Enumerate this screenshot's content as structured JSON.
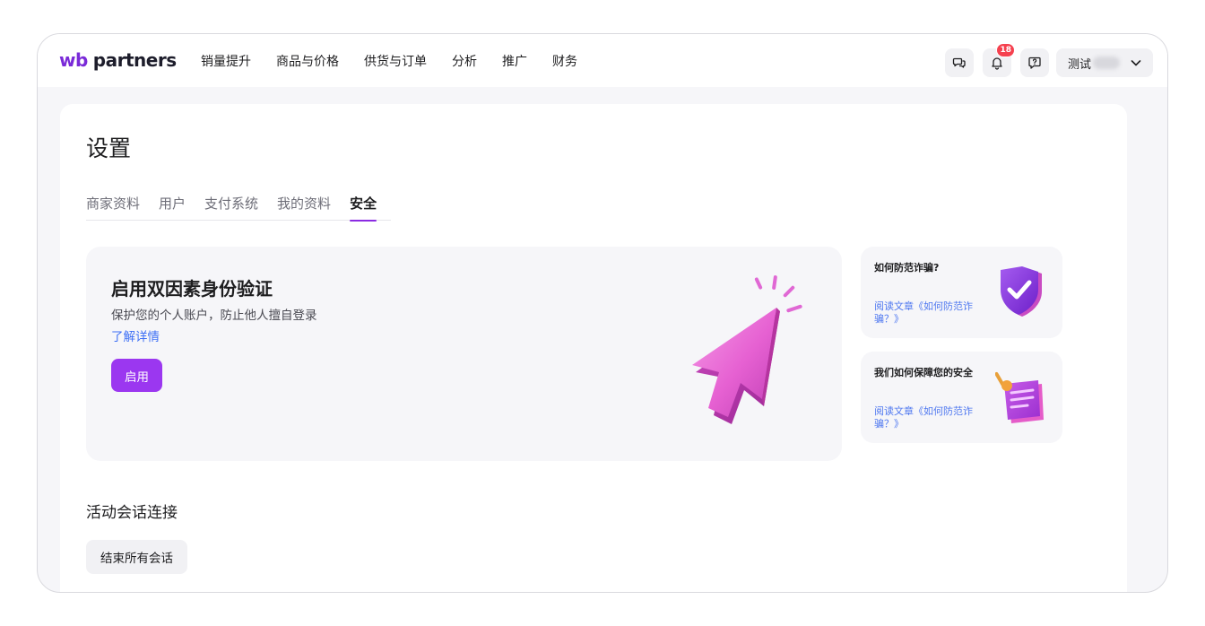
{
  "header": {
    "logo_prefix": "wb",
    "logo_suffix": "partners",
    "nav": [
      "销量提升",
      "商品与价格",
      "供货与订单",
      "分析",
      "推广",
      "财务"
    ],
    "notifications_count": "18",
    "user_name": "测试"
  },
  "page": {
    "title": "设置",
    "tabs": [
      "商家资料",
      "用户",
      "支付系统",
      "我的资料",
      "安全"
    ],
    "active_tab": "安全"
  },
  "two_factor": {
    "title": "启用双因素身份验证",
    "description": "保护您的个人账户，防止他人擅自登录",
    "link": "了解详情",
    "button": "启用"
  },
  "side_cards": [
    {
      "title": "如何防范诈骗?",
      "link": "阅读文章《如何防范诈骗？》"
    },
    {
      "title": "我们如何保障您的安全",
      "link": "阅读文章《如何防范诈骗？》"
    }
  ],
  "sessions": {
    "title": "活动会话连接",
    "end_button": "结束所有会话"
  },
  "colors": {
    "accent": "#9b37f0",
    "link": "#3d6ff5",
    "badge": "#f5414f"
  },
  "icons": {
    "chat": "chat-bubbles-icon",
    "notifications": "bell-icon",
    "support": "help-chat-icon",
    "user_menu": "chevron-down-icon"
  }
}
